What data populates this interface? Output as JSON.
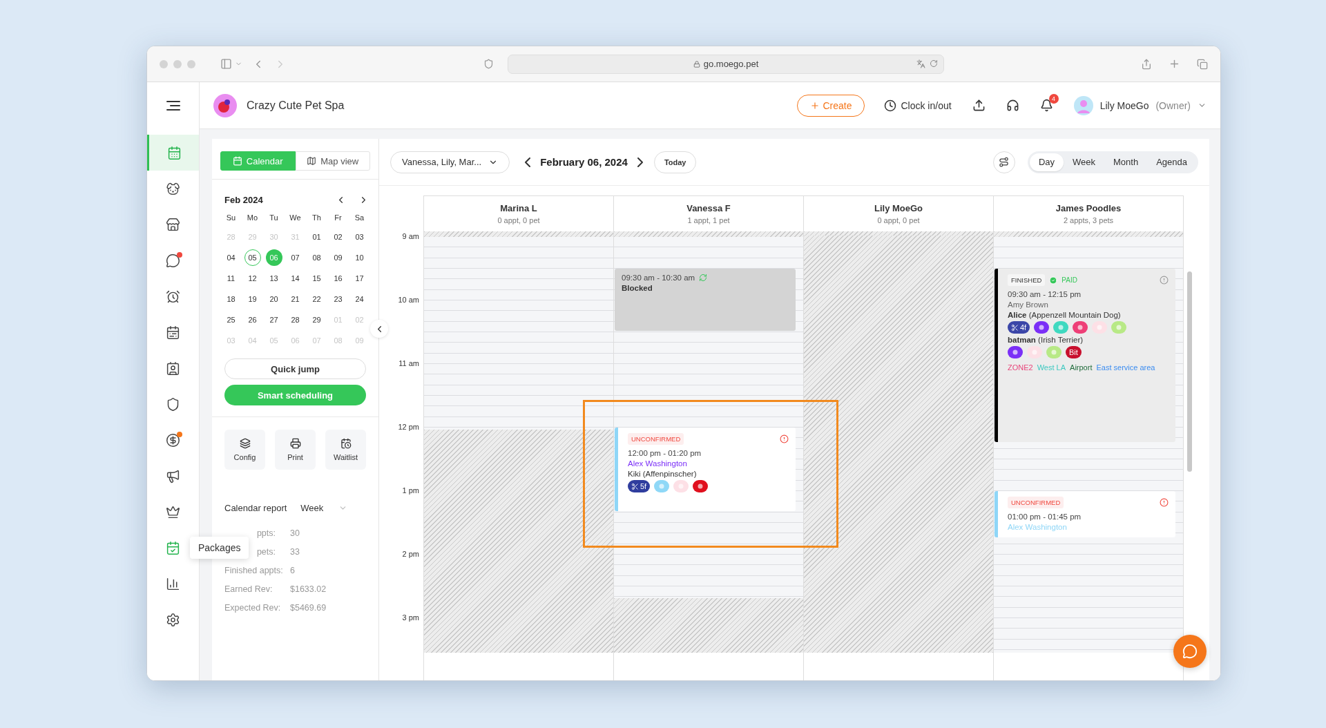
{
  "browser": {
    "url": "go.moego.pet"
  },
  "sidebar": {
    "items": [
      {
        "selected": true,
        "hovered": false
      },
      {
        "selected": false,
        "hovered": false
      },
      {
        "selected": false,
        "hovered": false
      },
      {
        "selected": false,
        "hovered": false,
        "color": "#f0483e"
      },
      {
        "selected": false,
        "hovered": false
      },
      {
        "selected": false,
        "hovered": false
      },
      {
        "selected": false,
        "hovered": false
      },
      {
        "selected": false,
        "hovered": false
      },
      {
        "selected": false,
        "hovered": false,
        "color": "#f5761a"
      },
      {
        "selected": false,
        "hovered": false
      },
      {
        "selected": false,
        "hovered": false
      },
      {
        "selected": false,
        "hovered": true,
        "tooltip": "Packages"
      },
      {
        "selected": false,
        "hovered": false
      },
      {
        "selected": false,
        "hovered": false
      }
    ]
  },
  "header": {
    "business": "Crazy Cute Pet Spa",
    "create": "Create",
    "clock": "Clock in/out",
    "notifications": "4",
    "user": "Lily MoeGo",
    "role": "(Owner)"
  },
  "view_toggle": [
    {
      "label": "Calendar",
      "selected": true
    },
    {
      "label": "Map view",
      "selected": false
    }
  ],
  "mini_calendar": {
    "title": "Feb 2024",
    "weekdays": [
      "Su",
      "Mo",
      "Tu",
      "We",
      "Th",
      "Fr",
      "Sa"
    ],
    "weeks": [
      [
        {
          "label": "28",
          "muted": true,
          "today": false,
          "selected": false
        },
        {
          "label": "29",
          "muted": true,
          "today": false,
          "selected": false
        },
        {
          "label": "30",
          "muted": true,
          "today": false,
          "selected": false
        },
        {
          "label": "31",
          "muted": true,
          "today": false,
          "selected": false
        },
        {
          "label": "01",
          "muted": false,
          "today": false,
          "selected": false
        },
        {
          "label": "02",
          "muted": false,
          "today": false,
          "selected": false
        },
        {
          "label": "03",
          "muted": false,
          "today": false,
          "selected": false
        }
      ],
      [
        {
          "label": "04",
          "muted": false,
          "today": false,
          "selected": false
        },
        {
          "label": "05",
          "muted": false,
          "today": true,
          "selected": false
        },
        {
          "label": "06",
          "muted": false,
          "today": false,
          "selected": true
        },
        {
          "label": "07",
          "muted": false,
          "today": false,
          "selected": false
        },
        {
          "label": "08",
          "muted": false,
          "today": false,
          "selected": false
        },
        {
          "label": "09",
          "muted": false,
          "today": false,
          "selected": false
        },
        {
          "label": "10",
          "muted": false,
          "today": false,
          "selected": false
        }
      ],
      [
        {
          "label": "11",
          "muted": false,
          "today": false,
          "selected": false
        },
        {
          "label": "12",
          "muted": false,
          "today": false,
          "selected": false
        },
        {
          "label": "13",
          "muted": false,
          "today": false,
          "selected": false
        },
        {
          "label": "14",
          "muted": false,
          "today": false,
          "selected": false
        },
        {
          "label": "15",
          "muted": false,
          "today": false,
          "selected": false
        },
        {
          "label": "16",
          "muted": false,
          "today": false,
          "selected": false
        },
        {
          "label": "17",
          "muted": false,
          "today": false,
          "selected": false
        }
      ],
      [
        {
          "label": "18",
          "muted": false,
          "today": false,
          "selected": false
        },
        {
          "label": "19",
          "muted": false,
          "today": false,
          "selected": false
        },
        {
          "label": "20",
          "muted": false,
          "today": false,
          "selected": false
        },
        {
          "label": "21",
          "muted": false,
          "today": false,
          "selected": false
        },
        {
          "label": "22",
          "muted": false,
          "today": false,
          "selected": false
        },
        {
          "label": "23",
          "muted": false,
          "today": false,
          "selected": false
        },
        {
          "label": "24",
          "muted": false,
          "today": false,
          "selected": false
        }
      ],
      [
        {
          "label": "25",
          "muted": false,
          "today": false,
          "selected": false
        },
        {
          "label": "26",
          "muted": false,
          "today": false,
          "selected": false
        },
        {
          "label": "27",
          "muted": false,
          "today": false,
          "selected": false
        },
        {
          "label": "28",
          "muted": false,
          "today": false,
          "selected": false
        },
        {
          "label": "29",
          "muted": false,
          "today": false,
          "selected": false
        },
        {
          "label": "01",
          "muted": true,
          "today": false,
          "selected": false
        },
        {
          "label": "02",
          "muted": true,
          "today": false,
          "selected": false
        }
      ],
      [
        {
          "label": "03",
          "muted": true,
          "today": false,
          "selected": false
        },
        {
          "label": "04",
          "muted": true,
          "today": false,
          "selected": false
        },
        {
          "label": "05",
          "muted": true,
          "today": false,
          "selected": false
        },
        {
          "label": "06",
          "muted": true,
          "today": false,
          "selected": false
        },
        {
          "label": "07",
          "muted": true,
          "today": false,
          "selected": false
        },
        {
          "label": "08",
          "muted": true,
          "today": false,
          "selected": false
        },
        {
          "label": "09",
          "muted": true,
          "today": false,
          "selected": false
        }
      ]
    ]
  },
  "quick_jump": "Quick jump",
  "smart_scheduling": "Smart scheduling",
  "tools": [
    {
      "kind": "config",
      "label": "Config"
    },
    {
      "kind": "print",
      "label": "Print"
    },
    {
      "kind": "waitlist",
      "label": "Waitlist"
    }
  ],
  "report": {
    "title": "Calendar report",
    "period": "Week",
    "rows": [
      {
        "label": "ppts:",
        "value": "30",
        "covered": true
      },
      {
        "label": "pets:",
        "value": "33",
        "covered": true
      },
      {
        "label": "Finished appts:",
        "value": "6"
      },
      {
        "label": "Earned Rev:",
        "value": "$1633.02"
      },
      {
        "label": "Expected Rev:",
        "value": "$5469.69"
      }
    ]
  },
  "toolbar": {
    "staff": "Vanessa, Lily, Mar...",
    "date": "February 06, 2024",
    "today": "Today",
    "views": [
      {
        "label": "Day",
        "selected": true
      },
      {
        "label": "Week",
        "selected": false
      },
      {
        "label": "Month",
        "selected": false
      },
      {
        "label": "Agenda",
        "selected": false
      }
    ]
  },
  "hours": [
    "9 am",
    "10 am",
    "11 am",
    "12 pm",
    "1 pm",
    "2 pm",
    "3 pm"
  ],
  "columns": [
    {
      "name": "Marina L",
      "summary": "0 appt, 0 pet",
      "unavailable": {
        "level": 0.53
      }
    },
    {
      "name": "Vanessa F",
      "summary": "1 appt, 1 pet",
      "unavailable": {
        "level": 0.13
      },
      "events": [
        {
          "kind": "blocked",
          "time": "09:30 am - 10:30 am",
          "title": "Blocked",
          "repeating": true
        },
        {
          "kind": "appointment",
          "color": "#8fd6f7",
          "status": {
            "label": "UNCONFIRMED",
            "kind": "unconfirmed"
          },
          "time": "12:00 pm - 01:20 pm",
          "client": {
            "name": "Alex Washington",
            "color": "#7b2ff7"
          },
          "pets": [
            {
              "name": "Kiki (Affenpinscher)",
              "tags": [
                {
                  "kind": "grooming",
                  "text": "5f",
                  "color": "#2f3d9e"
                },
                {
                  "kind": "icon",
                  "color": "#8fd8f7"
                },
                {
                  "kind": "icon",
                  "color": "#fde0e6"
                },
                {
                  "kind": "icon",
                  "color": "#e0101e"
                }
              ]
            }
          ]
        }
      ]
    },
    {
      "name": "Lily MoeGo",
      "summary": "0 appt, 0 pet",
      "unavailable": {
        "level": 0.99
      }
    },
    {
      "name": "James Poodles",
      "summary": "2 appts, 3 pets",
      "events": [
        {
          "kind": "appointment",
          "color": "#000000",
          "status": {
            "label": "FINISHED",
            "kind": "finished"
          },
          "payment": {
            "label": "PAID",
            "kind": "paid"
          },
          "time": "09:30 am - 12:15 pm",
          "client": {
            "name": "Amy Brown",
            "color": "#666666"
          },
          "pets": [
            {
              "name": "**Alice** (Appenzell Mountain Dog)",
              "tags": [
                {
                  "kind": "grooming",
                  "text": "4f",
                  "color": "#3b46a8"
                },
                {
                  "kind": "icon",
                  "color": "#7b2ff7"
                },
                {
                  "kind": "icon",
                  "color": "#3fd9c0"
                },
                {
                  "kind": "icon",
                  "color": "#ee3f77"
                },
                {
                  "kind": "icon",
                  "color": "#fde0e6"
                },
                {
                  "kind": "icon",
                  "color": "#b8e986"
                }
              ]
            },
            {
              "name": "**batman** (Irish Terrier)",
              "tags": [
                {
                  "kind": "icon",
                  "color": "#7b2ff7"
                },
                {
                  "kind": "icon",
                  "color": "#fde0e6"
                },
                {
                  "kind": "icon",
                  "color": "#b8e986"
                },
                {
                  "kind": "text",
                  "text": "Bit",
                  "color": "#c8102e"
                }
              ]
            }
          ],
          "zones": [
            {
              "label": "ZONE2",
              "color": "#e8457b"
            },
            {
              "label": "West LA",
              "color": "#3cc8c0"
            },
            {
              "label": "Airport",
              "color": "#1f6b3a"
            },
            {
              "label": "East service area",
              "color": "#3b8cf0"
            }
          ]
        },
        {
          "kind": "appointment",
          "color": "#8fd6f7",
          "status": {
            "label": "UNCONFIRMED",
            "kind": "unconfirmed"
          },
          "time": "01:00 pm - 01:45 pm",
          "client": {
            "name": "Alex Washington",
            "color": "#8fd6f7"
          }
        }
      ]
    }
  ]
}
